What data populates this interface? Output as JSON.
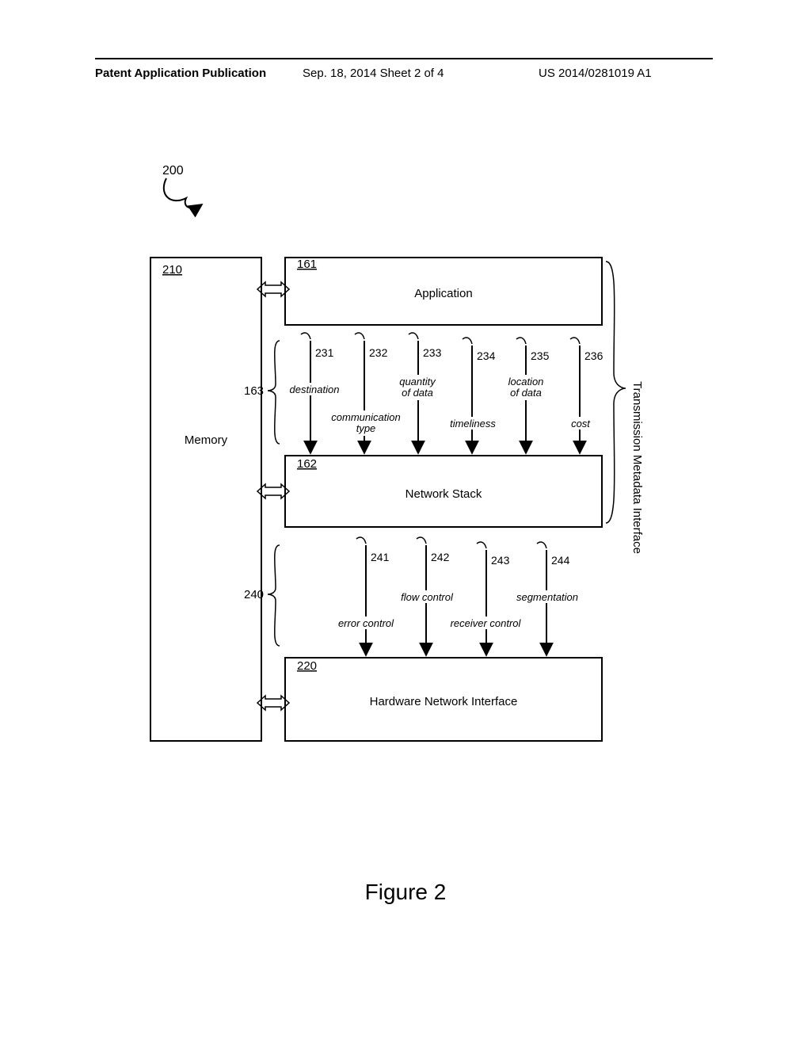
{
  "header": {
    "left": "Patent Application Publication",
    "center": "Sep. 18, 2014  Sheet 2 of 4",
    "right": "US 2014/0281019 A1"
  },
  "figure_label": "Figure 2",
  "ref_numbers": {
    "system": "200",
    "memory_block": "210",
    "hardware_block": "220",
    "app_block": "161",
    "stack_block": "162",
    "group_163": "163",
    "group_240": "240",
    "a231": "231",
    "a232": "232",
    "a233": "233",
    "a234": "234",
    "a235": "235",
    "a236": "236",
    "a241": "241",
    "a242": "242",
    "a243": "243",
    "a244": "244"
  },
  "labels": {
    "memory": "Memory",
    "application": "Application",
    "network_stack": "Network Stack",
    "hardware_interface": "Hardware Network Interface",
    "side_label": "Transmission Metadata Interface",
    "destination": "destination",
    "communication_type1": "communication",
    "communication_type2": "type",
    "quantity1": "quantity",
    "quantity2": "of data",
    "timeliness": "timeliness",
    "location1": "location",
    "location2": "of data",
    "cost": "cost",
    "error_control": "error control",
    "flow_control": "flow control",
    "receiver_control": "receiver control",
    "segmentation": "segmentation"
  }
}
